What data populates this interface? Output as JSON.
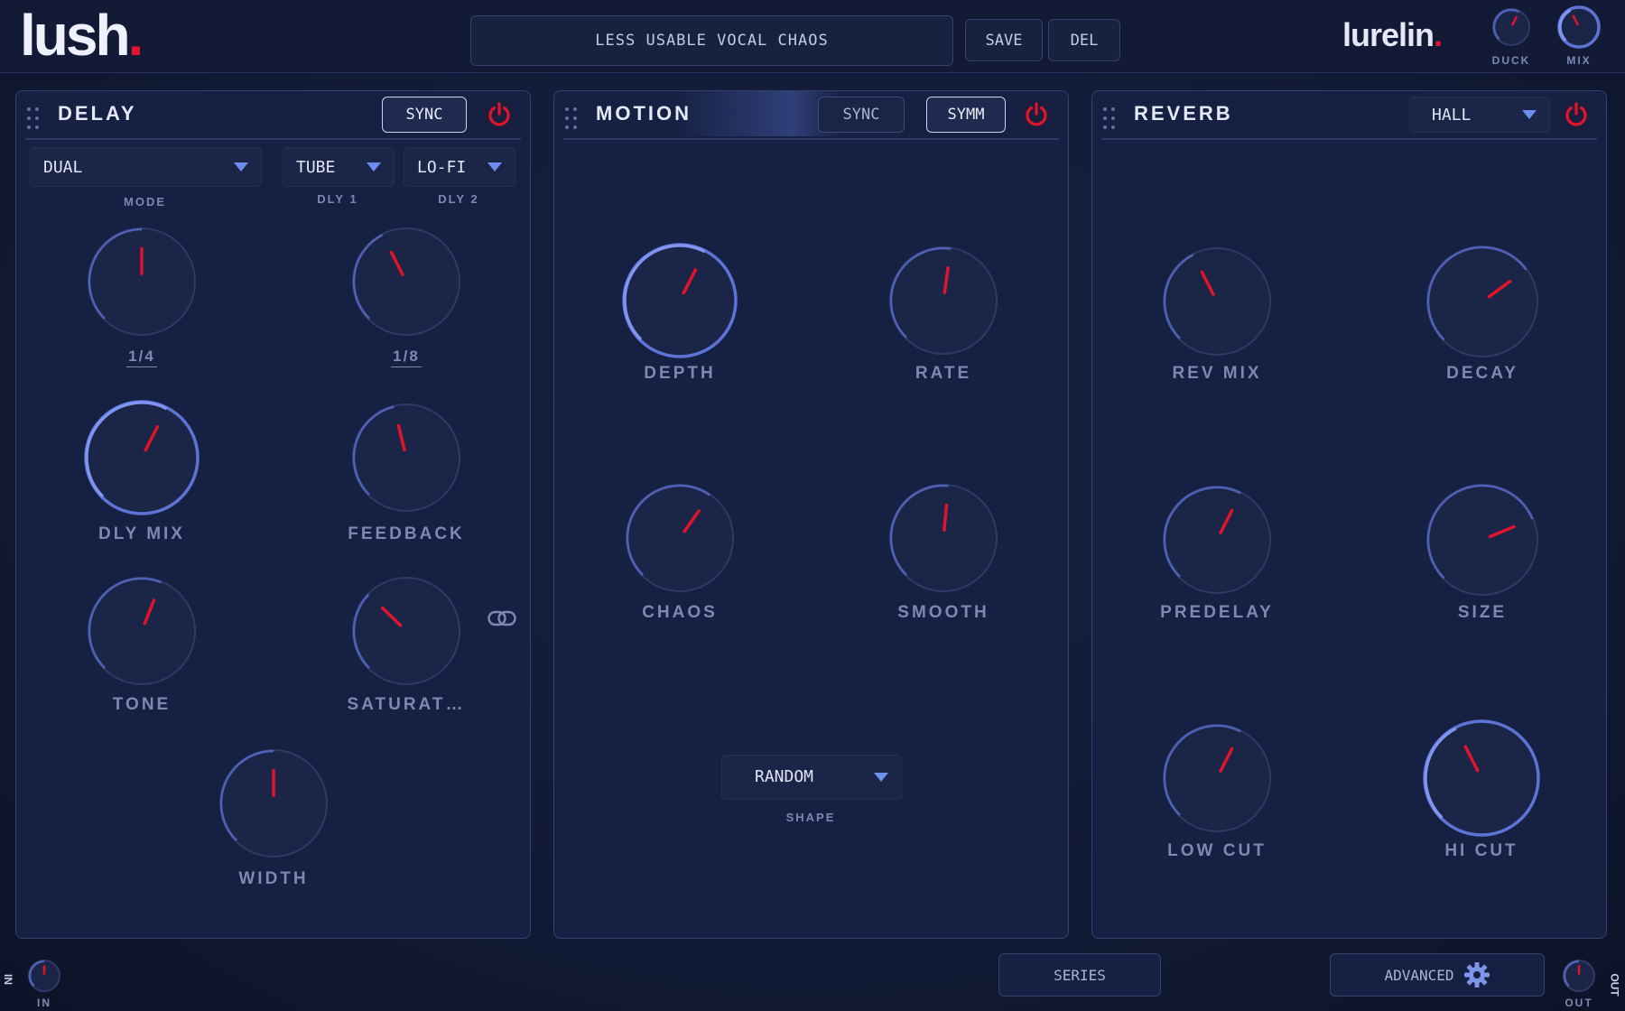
{
  "header": {
    "logo": "lush",
    "logo_dot": ".",
    "preset_name": "LESS USABLE VOCAL CHAOS",
    "save_label": "SAVE",
    "del_label": "DEL",
    "brand": "lurelin",
    "brand_dot": ".",
    "duck_label": "DUCK",
    "mix_label": "MIX"
  },
  "delay": {
    "title": "DELAY",
    "sync_label": "SYNC",
    "mode_value": "DUAL",
    "mode_label": "MODE",
    "dly1_value": "TUBE",
    "dly1_label": "DLY 1",
    "dly2_value": "LO-FI",
    "dly2_label": "DLY 2",
    "time1_value": "1/4",
    "time2_value": "1/8",
    "dly_mix_label": "DLY MIX",
    "feedback_label": "FEEDBACK",
    "tone_label": "TONE",
    "saturation_label": "SATURAT…",
    "width_label": "WIDTH"
  },
  "motion": {
    "title": "MOTION",
    "sync_label": "SYNC",
    "symm_label": "SYMM",
    "depth_label": "DEPTH",
    "rate_label": "RATE",
    "chaos_label": "CHAOS",
    "smooth_label": "SMOOTH",
    "shape_value": "RANDOM",
    "shape_label": "SHAPE"
  },
  "reverb": {
    "title": "REVERB",
    "type_value": "HALL",
    "rev_mix_label": "REV MIX",
    "decay_label": "DECAY",
    "predelay_label": "PREDELAY",
    "size_label": "SIZE",
    "low_cut_label": "LOW CUT",
    "hi_cut_label": "HI CUT"
  },
  "footer": {
    "in_label": "IN",
    "in_side": "IN",
    "series_label": "SERIES",
    "advanced_label": "ADVANCED",
    "out_label": "OUT",
    "out_side": "OUT"
  },
  "colors": {
    "background": "#111a35",
    "panel": "#152042",
    "accent_red": "#e0142b",
    "knob_ring": "#5d73d6",
    "arrow_blue": "#6f8cf0"
  },
  "knob_levels": {
    "duck": 0.6,
    "mix": 0.4,
    "delay_time1": 0.5,
    "delay_time2": 0.4,
    "dly_mix": 0.6,
    "feedback": 0.45,
    "tone": 0.58,
    "saturation": 0.33,
    "width": 0.5,
    "depth": 0.6,
    "rate": 0.53,
    "chaos": 0.63,
    "smooth": 0.52,
    "rev_mix": 0.4,
    "decay": 0.7,
    "predelay": 0.6,
    "size": 0.75,
    "low_cut": 0.6,
    "hi_cut": 0.4,
    "in": 0.5,
    "out": 0.5
  }
}
